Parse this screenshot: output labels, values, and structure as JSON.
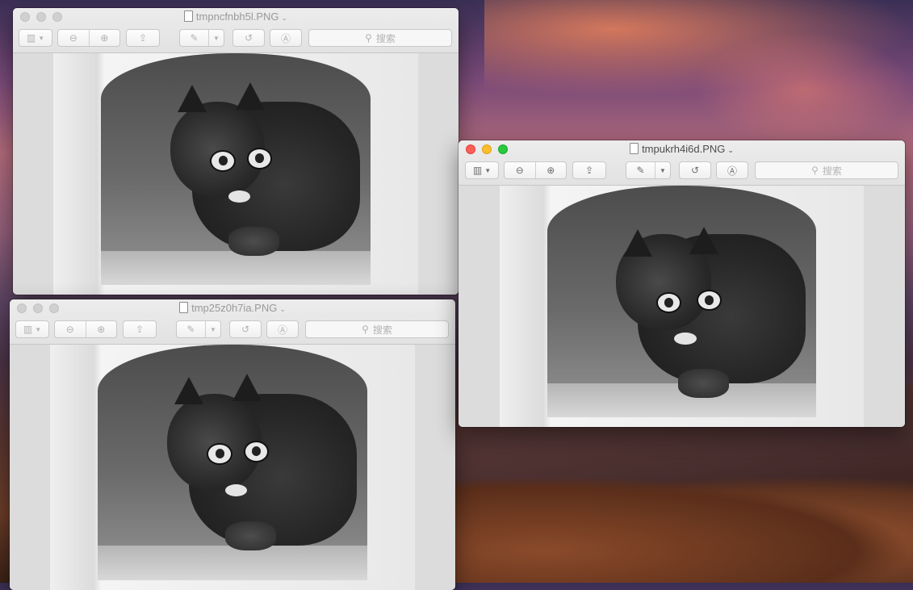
{
  "desktop": {
    "wallpaper": "sierra-sunset-mountains"
  },
  "windows": [
    {
      "id": "w1",
      "title": "tmpncfnbh5l.PNG",
      "active": false,
      "search_placeholder": "搜索"
    },
    {
      "id": "w2",
      "title": "tmp25z0h7ia.PNG",
      "active": false,
      "search_placeholder": "搜索"
    },
    {
      "id": "w3",
      "title": "tmpukrh4i6d.PNG",
      "active": true,
      "search_placeholder": "搜索"
    }
  ],
  "icons": {
    "sidebar": "sidebar-toggle-icon",
    "zoom_out": "zoom-out-icon",
    "zoom_in": "zoom-in-icon",
    "share": "share-icon",
    "markup": "pen-markup-icon",
    "rotate": "rotate-left-icon",
    "annotate": "markup-toolbar-icon",
    "search": "search-icon",
    "chevron": "chevron-down-icon"
  },
  "colors": {
    "close": "#fc5f57",
    "minimize": "#fdbd2e",
    "maximize": "#28c840"
  }
}
